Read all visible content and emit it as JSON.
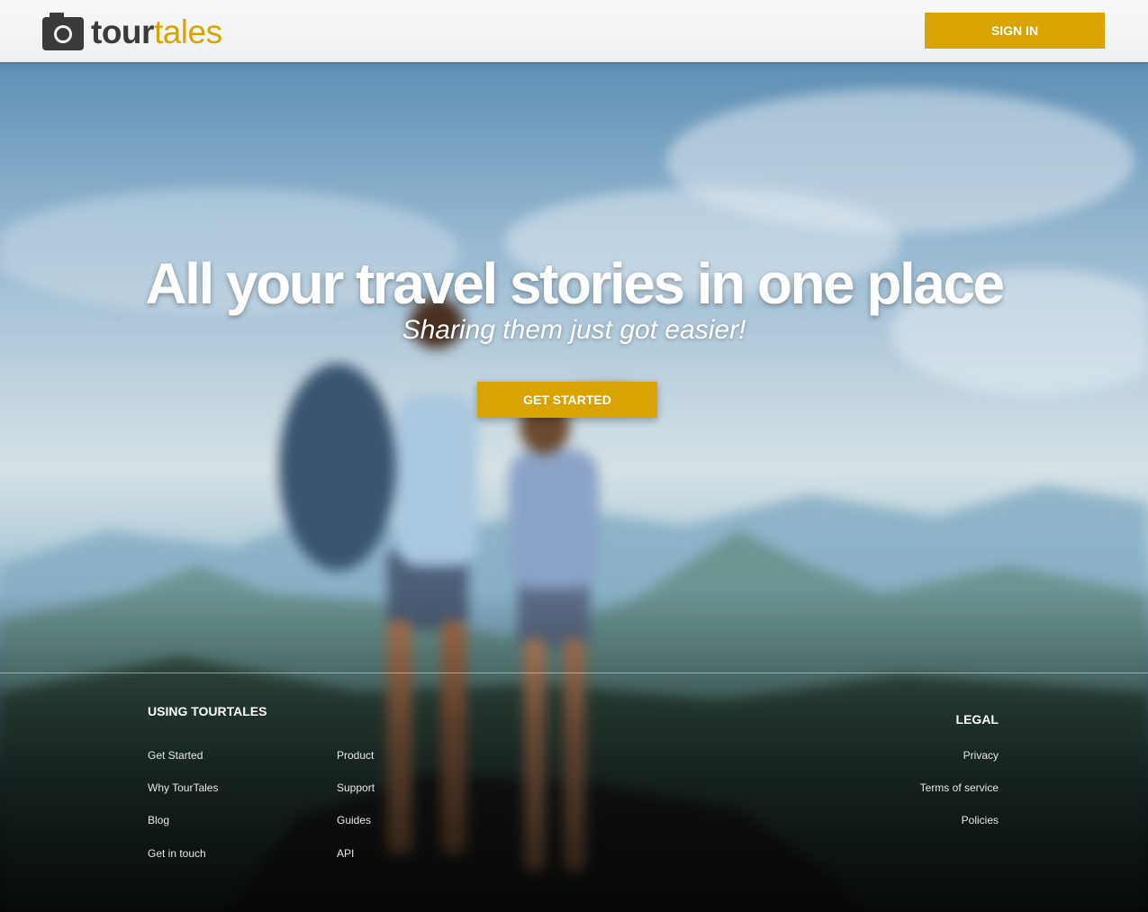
{
  "header": {
    "logo": {
      "word_dark": "tour",
      "word_accent": "tales",
      "icon": "camera-icon"
    },
    "signin_label": "SIGN IN"
  },
  "hero": {
    "title": "All your travel stories in one place",
    "subtitle": "Sharing them just got easier!",
    "cta_label": "GET STARTED"
  },
  "footer": {
    "using": {
      "heading": "USING TOURTALES",
      "col1": [
        "Get Started",
        "Why TourTales",
        "Blog",
        "Get in touch"
      ],
      "col2": [
        "Product",
        "Support",
        "Guides",
        "API"
      ]
    },
    "legal": {
      "heading": "LEGAL",
      "links": [
        "Privacy",
        "Terms of service",
        "Policies"
      ]
    }
  },
  "colors": {
    "accent": "#d9a300",
    "header_bg": "#f3f4f5",
    "logo_dark": "#3a3a3a"
  }
}
